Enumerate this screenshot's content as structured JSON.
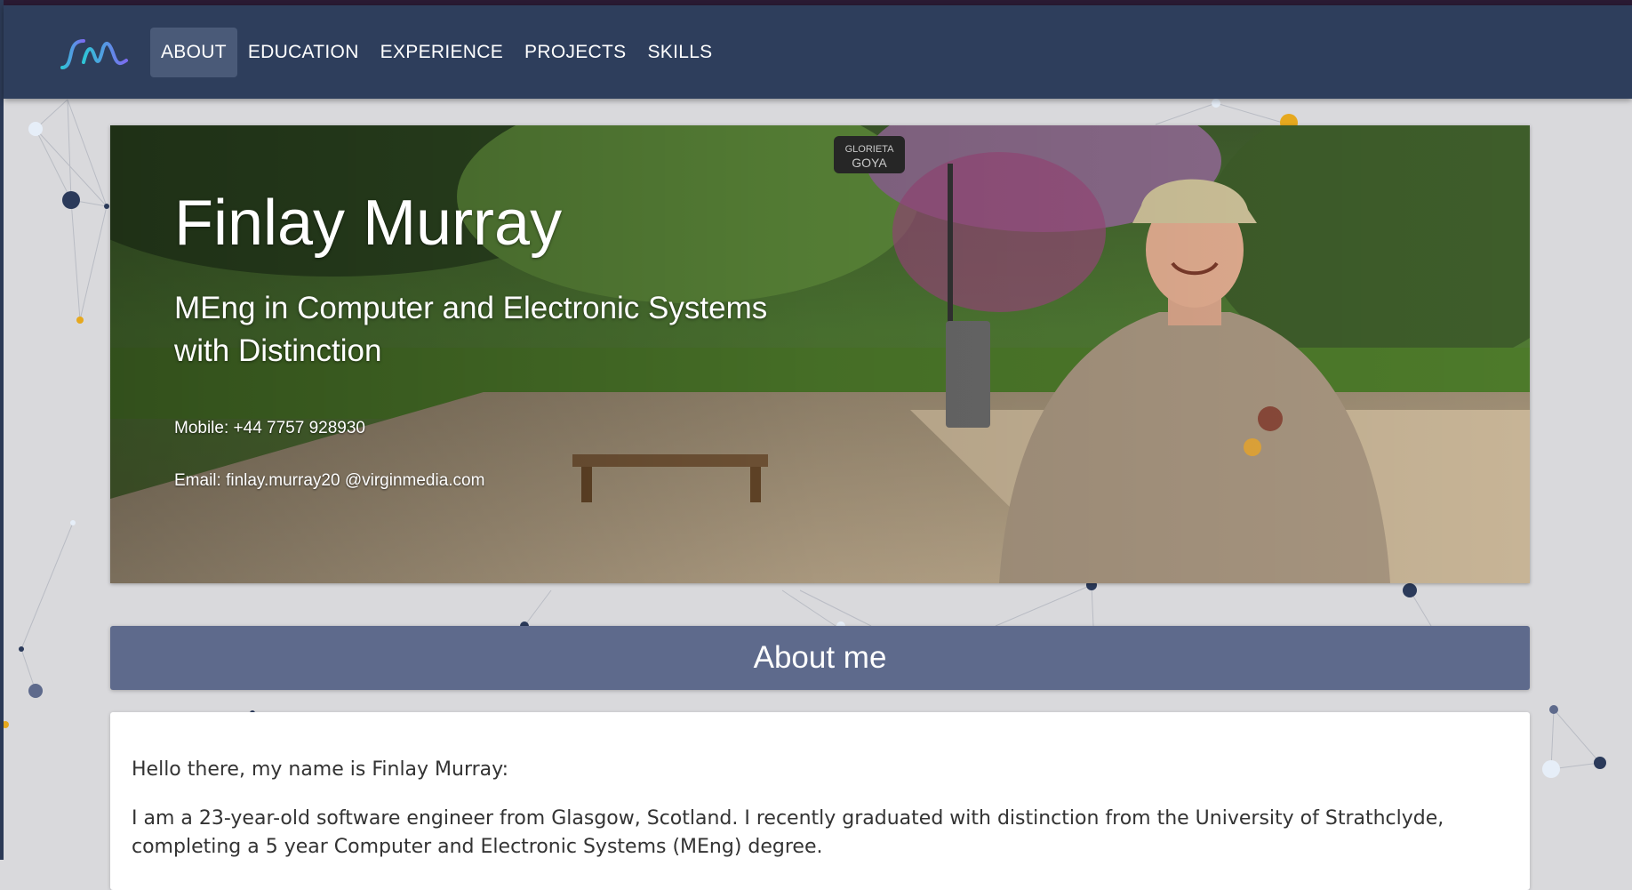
{
  "colors": {
    "navbar": "#2e3e5c",
    "nav_active": "#4a5a78",
    "section_header": "#5e6a8c",
    "page_bg": "#d9d9dc",
    "logo_gradient_start": "#2ec5d6",
    "logo_gradient_end": "#7b6cf0"
  },
  "header": {
    "logo_icon": "fm-logo-icon",
    "nav": [
      {
        "label": "ABOUT",
        "active": true
      },
      {
        "label": "EDUCATION",
        "active": false
      },
      {
        "label": "EXPERIENCE",
        "active": false
      },
      {
        "label": "PROJECTS",
        "active": false
      },
      {
        "label": "SKILLS",
        "active": false
      }
    ]
  },
  "hero": {
    "name": "Finlay Murray",
    "degree": "MEng in Computer and Electronic Systems with Distinction",
    "mobile": "Mobile: +44 7757 928930",
    "email": "Email: finlay.murray20 @virginmedia.com",
    "sign_text": "GLORIETA DE GOYA"
  },
  "about": {
    "heading": "About me",
    "paragraphs": [
      "Hello there, my name is Finlay Murray:",
      "I am a 23-year-old software engineer from Glasgow, Scotland. I recently graduated with distinction from the University of Strathclyde, completing a 5 year Computer and Electronic Systems (MEng) degree."
    ]
  }
}
